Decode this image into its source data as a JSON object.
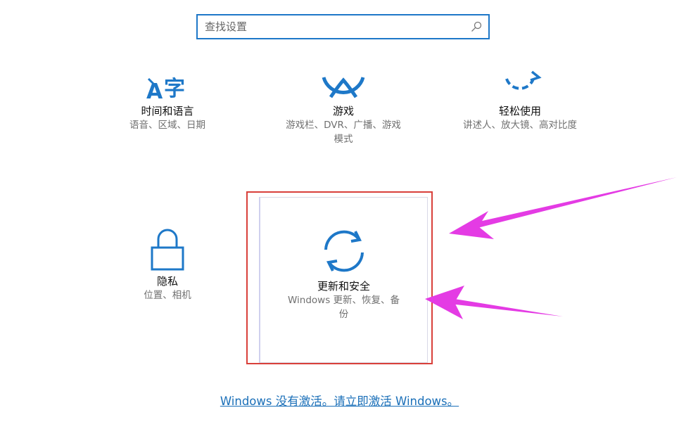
{
  "search": {
    "placeholder": "查找设置",
    "icon": "search-icon"
  },
  "tiles": [
    {
      "id": "time-language",
      "icon": "time-language-icon",
      "title": "时间和语言",
      "desc": "语音、区域、日期"
    },
    {
      "id": "gaming",
      "icon": "xbox-icon",
      "title": "游戏",
      "desc_line1": "游戏栏、DVR、广播、游戏",
      "desc_line2": "模式"
    },
    {
      "id": "ease-of-access",
      "icon": "ease-of-access-icon",
      "title": "轻松使用",
      "desc": "讲述人、放大镜、高对比度"
    },
    {
      "id": "privacy",
      "icon": "lock-icon",
      "title": "隐私",
      "desc": "位置、相机"
    },
    {
      "id": "update-security",
      "icon": "sync-icon",
      "title": "更新和安全",
      "desc_line1": "Windows 更新、恢复、备",
      "desc_line2": "份"
    }
  ],
  "activation": {
    "text": "Windows 没有激活。请立即激活 Windows。"
  },
  "colors": {
    "accent": "#1e78c8",
    "highlight_box": "#d9403a",
    "arrow": "#e43be4",
    "link": "#1a6fb8"
  }
}
